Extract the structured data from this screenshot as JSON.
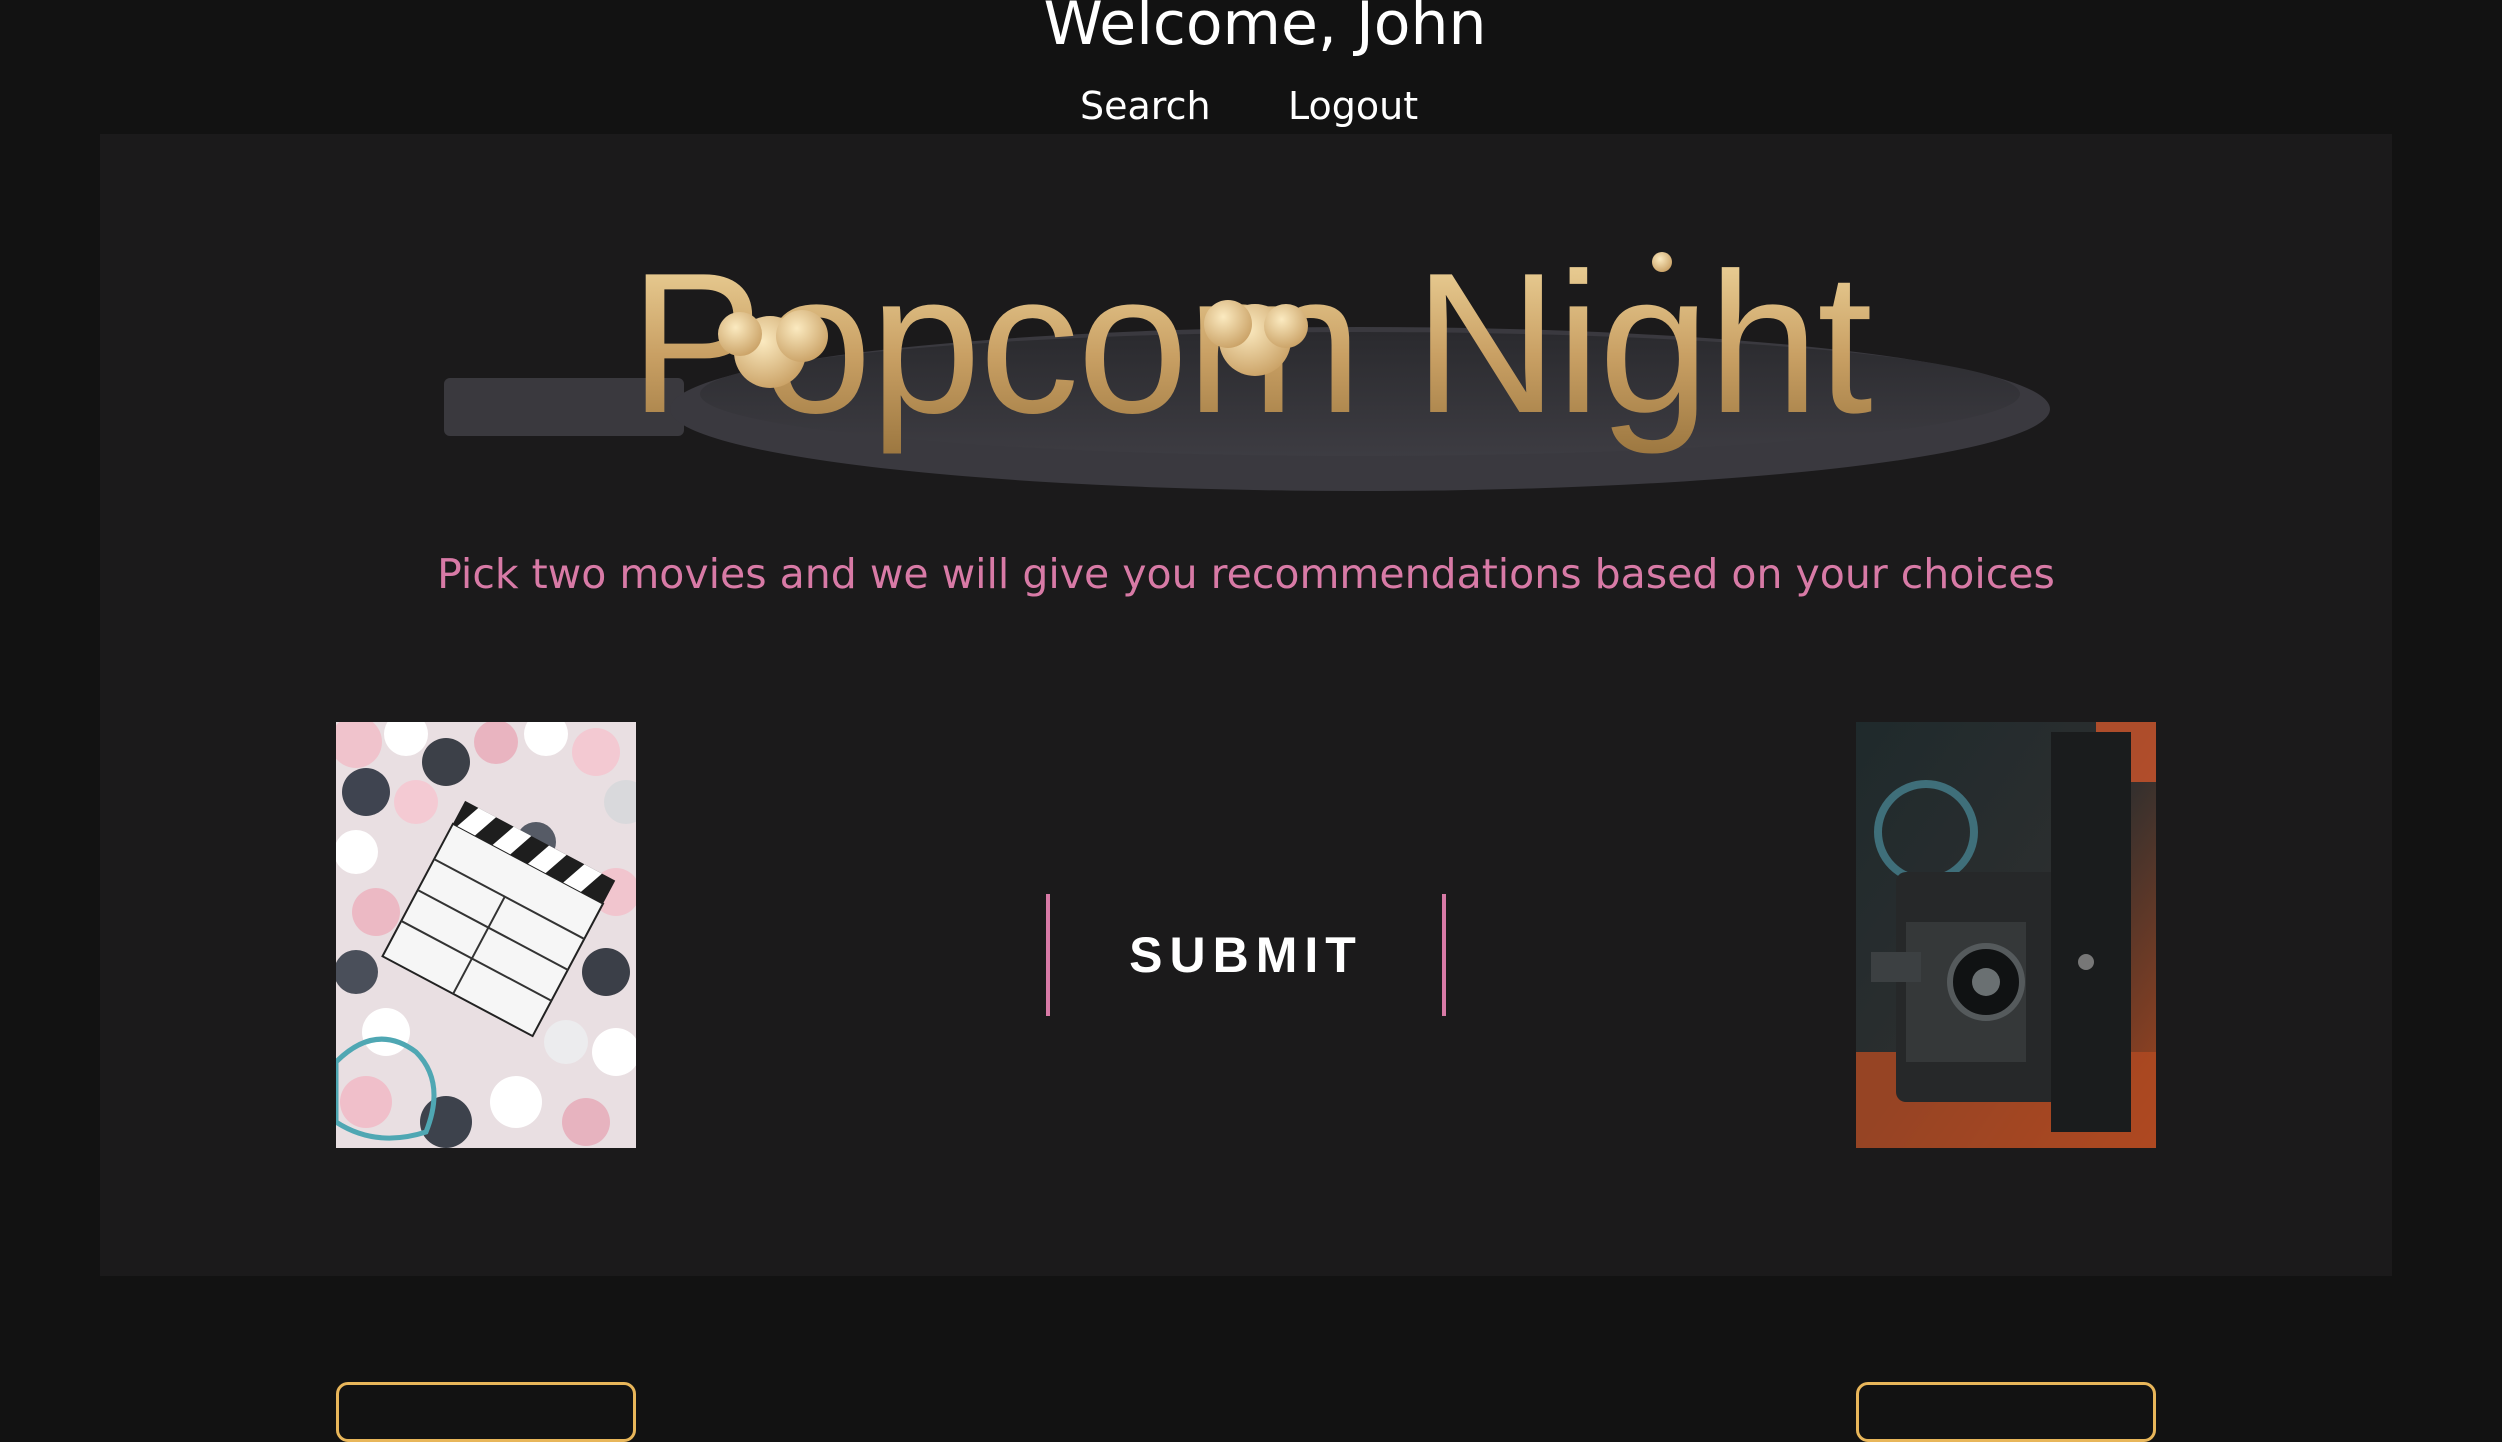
{
  "header": {
    "welcome": "Welcome, John",
    "nav": [
      {
        "label": "Search"
      },
      {
        "label": "Logout"
      }
    ]
  },
  "logo": {
    "text": "Popcorn Night"
  },
  "tagline": "Pick two movies and we will give you recommendations based on your choices",
  "submit_label": "SUBMIT",
  "posters": [
    {
      "subject": "clapperboard-in-ball-pit"
    },
    {
      "subject": "film-projector"
    }
  ],
  "colors": {
    "background": "#121212",
    "panel": "#1b1a1b",
    "accent_pink": "#d87aa6",
    "accent_gold": "#e8b65a",
    "text": "#ffffff"
  }
}
